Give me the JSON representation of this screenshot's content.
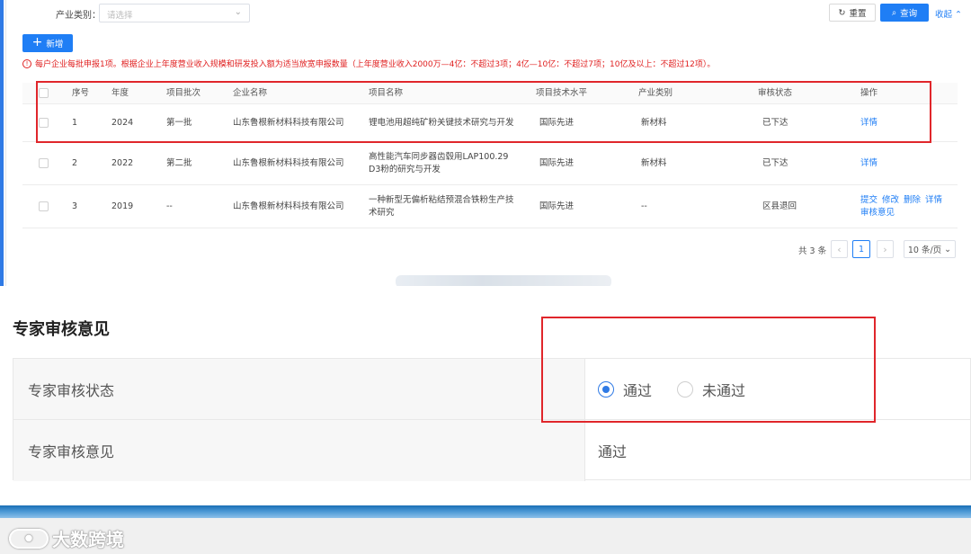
{
  "filter": {
    "label": "产业类别：",
    "placeholder": "请选择"
  },
  "toolbar": {
    "reset_label": "重置",
    "query_label": "查询",
    "collapse_label": "收起"
  },
  "add_button_label": "新增",
  "notice": "每户企业每批申报1项。根据企业上年度营业收入规模和研发投入额为适当放宽申报数量（上年度营业收入2000万—4亿：不超过3项；4亿—10亿：不超过7项；10亿及以上：不超过12项）。",
  "table": {
    "headers": [
      "序号",
      "年度",
      "项目批次",
      "企业名称",
      "项目名称",
      "项目技术水平",
      "产业类别",
      "审核状态",
      "操作"
    ],
    "rows": [
      {
        "no": "1",
        "year": "2024",
        "batch": "第一批",
        "company": "山东鲁根新材料科技有限公司",
        "project": "锂电池用超纯矿粉关键技术研究与开发",
        "level": "国际先进",
        "category": "新材料",
        "status": "已下达",
        "actions": [
          "详情"
        ]
      },
      {
        "no": "2",
        "year": "2022",
        "batch": "第二批",
        "company": "山东鲁根新材料科技有限公司",
        "project": "高性能汽车同步器齿毂用LAP100.29 D3粉的研究与开发",
        "level": "国际先进",
        "category": "新材料",
        "status": "已下达",
        "actions": [
          "详情"
        ]
      },
      {
        "no": "3",
        "year": "2019",
        "batch": "--",
        "company": "山东鲁根新材料科技有限公司",
        "project": "一种新型无偏析粘结预混合铁粉生产技术研究",
        "level": "国际先进",
        "category": "--",
        "status": "区县退回",
        "actions": [
          "提交",
          "修改",
          "删除",
          "详情",
          "审核意见"
        ]
      }
    ]
  },
  "pagination": {
    "total": "共 3 条",
    "current": "1",
    "page_size": "10 条/页"
  },
  "review": {
    "title": "专家审核意见",
    "status_label": "专家审核状态",
    "options": [
      "通过",
      "未通过"
    ],
    "selected": "通过",
    "opinion_label": "专家审核意见",
    "opinion_value": "通过"
  },
  "watermark": "大数跨境",
  "colors": {
    "primary": "#1f7ef5",
    "highlight": "#e0262b",
    "notice": "#e02020"
  }
}
